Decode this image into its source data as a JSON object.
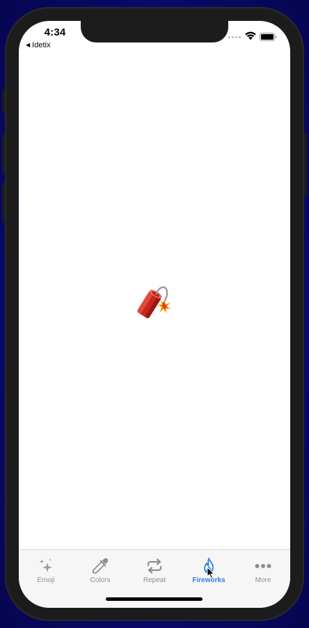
{
  "status_bar": {
    "time": "4:34",
    "back_label": "Idetix"
  },
  "content": {
    "emoji": "🧨",
    "emoji_name": "firecracker"
  },
  "tabs": [
    {
      "label": "Emoji",
      "icon": "sparkles-icon"
    },
    {
      "label": "Colors",
      "icon": "eyedropper-icon"
    },
    {
      "label": "Repeat",
      "icon": "repeat-icon"
    },
    {
      "label": "Fireworks",
      "icon": "flame-icon",
      "active": true
    },
    {
      "label": "More",
      "icon": "more-dots-icon"
    }
  ],
  "colors": {
    "active_tab": "#2f7fd9",
    "inactive_tab": "#8e8e8e"
  }
}
